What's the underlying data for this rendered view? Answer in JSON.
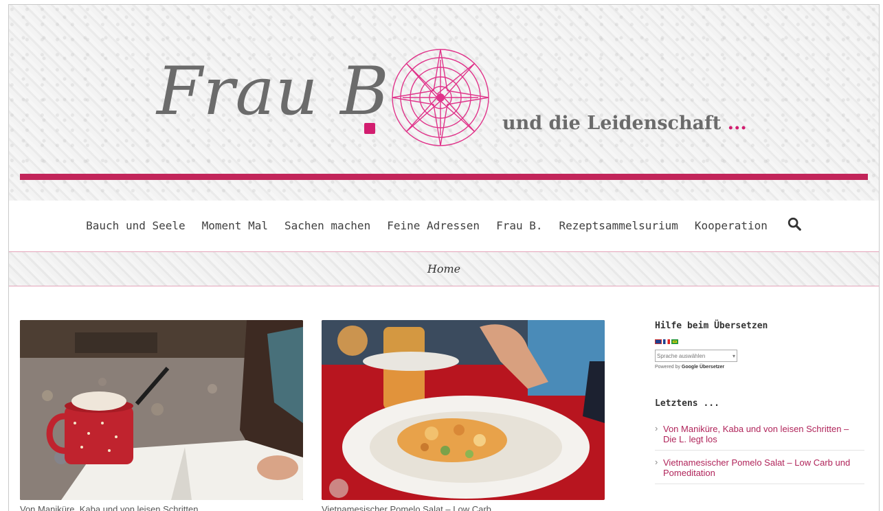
{
  "header": {
    "logo_text": "Frau B",
    "tagline": "und die Leidenschaft",
    "tagline_ellipsis": "...",
    "accent_color": "#c2255a",
    "logo_mark": "mandala-logo-icon"
  },
  "nav": {
    "items": [
      {
        "label": "Bauch und Seele"
      },
      {
        "label": "Moment Mal"
      },
      {
        "label": "Sachen machen"
      },
      {
        "label": "Feine Adressen"
      },
      {
        "label": "Frau B."
      },
      {
        "label": "Rezeptsammelsurium"
      },
      {
        "label": "Kooperation"
      }
    ],
    "search_icon": "search-icon"
  },
  "breadcrumb": {
    "current": "Home"
  },
  "posts": [
    {
      "image": "cocoa-cup-reading-book-photo",
      "title": "Von Maniküre, Kaba und von leisen Schritten"
    },
    {
      "image": "pomelo-salad-plate-photo",
      "title": "Vietnamesischer Pomelo Salat – Low Carb"
    }
  ],
  "sidebar": {
    "translate_widget": {
      "title": "Hilfe beim Übersetzen",
      "select_placeholder": "Sprache auswählen",
      "powered_by": "Powered by",
      "powered_brand": "Google Übersetzer"
    },
    "recent_widget": {
      "title": "Letztens ...",
      "items": [
        {
          "label": "Von Maniküre, Kaba und von leisen Schritten – Die L. legt los"
        },
        {
          "label": "Vietnamesischer Pomelo Salat – Low Carb und Pomeditation"
        }
      ]
    }
  }
}
